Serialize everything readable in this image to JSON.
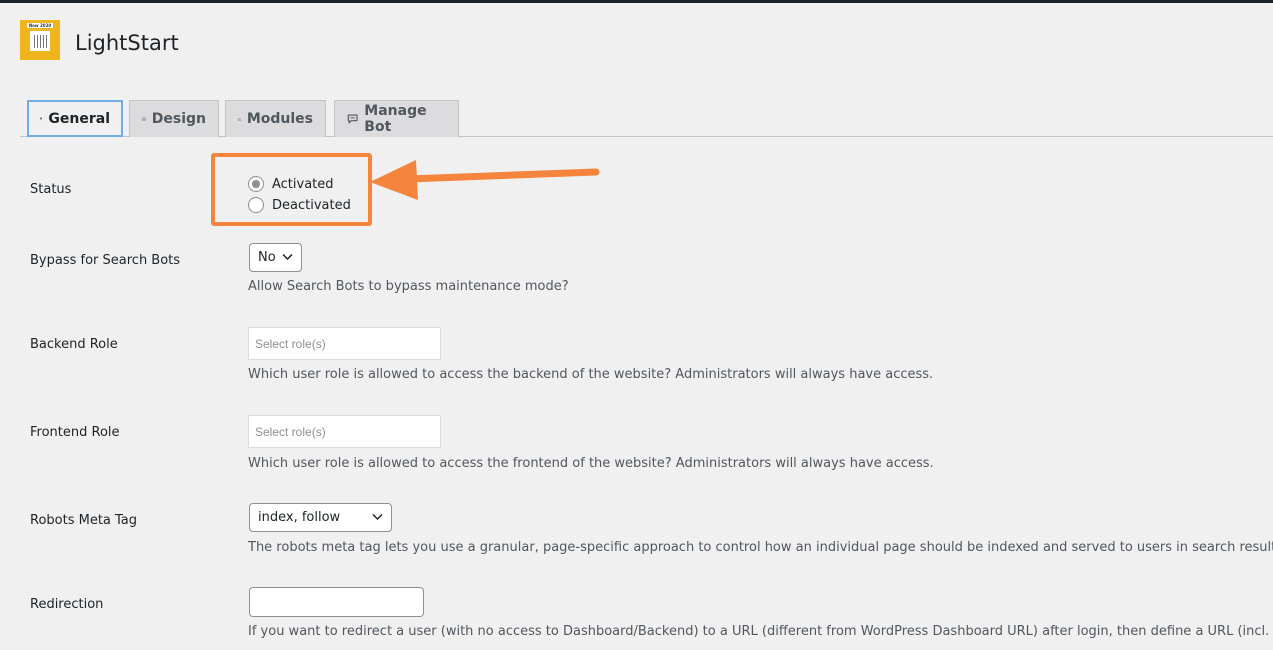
{
  "app": {
    "title": "LightStart",
    "logo_tag": "Now 2020"
  },
  "tabs": [
    {
      "label": "General",
      "icon": "sliders-icon",
      "active": true
    },
    {
      "label": "Design",
      "icon": "image-icon",
      "active": false
    },
    {
      "label": "Modules",
      "icon": "modules-icon",
      "active": false
    },
    {
      "label": "Manage Bot",
      "icon": "chat-icon",
      "active": false
    }
  ],
  "status": {
    "label": "Status",
    "options": [
      "Activated",
      "Deactivated"
    ],
    "selected": "Activated"
  },
  "bypass": {
    "label": "Bypass for Search Bots",
    "value": "No",
    "description": "Allow Search Bots to bypass maintenance mode?"
  },
  "backend_role": {
    "label": "Backend Role",
    "placeholder": "Select role(s)",
    "description": "Which user role is allowed to access the backend of the website? Administrators will always have access."
  },
  "frontend_role": {
    "label": "Frontend Role",
    "placeholder": "Select role(s)",
    "description": "Which user role is allowed to access the frontend of the website? Administrators will always have access."
  },
  "robots": {
    "label": "Robots Meta Tag",
    "value": "index, follow",
    "description": "The robots meta tag lets you use a granular, page-specific approach to control how an individual page should be indexed and served to users in search results."
  },
  "redirection": {
    "label": "Redirection",
    "value": "",
    "description": "If you want to redirect a user (with no access to Dashboard/Backend) to a URL (different from WordPress Dashboard URL) after login, then define a URL (incl. https://)"
  },
  "colors": {
    "accent": "#f5843c",
    "logo": "#f0b41c",
    "active_tab_border": "#72aee6"
  }
}
